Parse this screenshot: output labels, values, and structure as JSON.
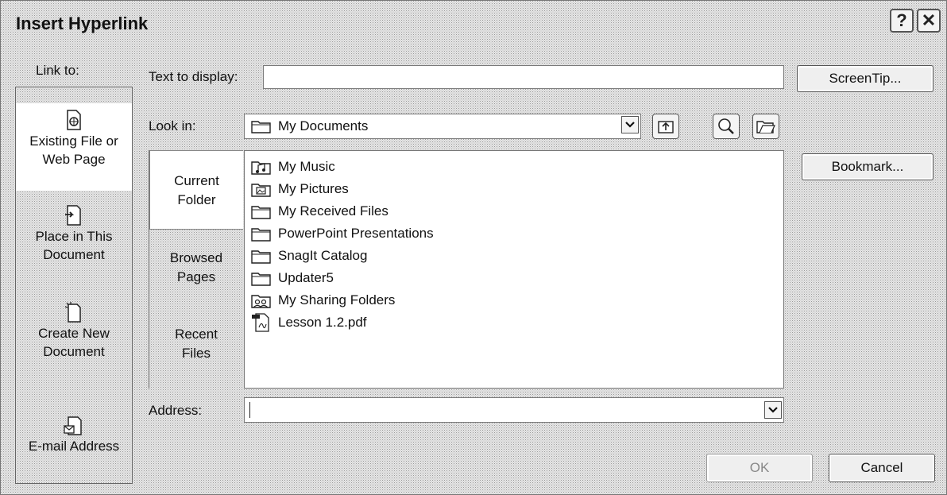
{
  "dialog": {
    "title": "Insert Hyperlink",
    "help_glyph": "?",
    "close_glyph": "✕"
  },
  "link_to": {
    "label": "Link to:",
    "items": [
      {
        "line1": "Existing File or",
        "line2": "Web Page",
        "icon": "existing-file-icon",
        "selected": true
      },
      {
        "line1": "Place in This",
        "line2": "Document",
        "icon": "place-in-document-icon",
        "selected": false
      },
      {
        "line1": "Create New",
        "line2": "Document",
        "icon": "create-new-document-icon",
        "selected": false
      },
      {
        "line1": "E-mail Address",
        "line2": "",
        "icon": "email-address-icon",
        "selected": false
      }
    ]
  },
  "text_to_display": {
    "label": "Text to display:",
    "value": ""
  },
  "screentip_label": "ScreenTip...",
  "look_in": {
    "label": "Look in:",
    "value": "My Documents"
  },
  "nav_tabs": [
    {
      "line1": "Current",
      "line2": "Folder",
      "selected": true
    },
    {
      "line1": "Browsed",
      "line2": "Pages",
      "selected": false
    },
    {
      "line1": "Recent",
      "line2": "Files",
      "selected": false
    }
  ],
  "files": [
    {
      "name": "My Music",
      "icon": "music-folder-icon"
    },
    {
      "name": "My Pictures",
      "icon": "pictures-folder-icon"
    },
    {
      "name": "My Received Files",
      "icon": "folder-icon"
    },
    {
      "name": "PowerPoint Presentations",
      "icon": "folder-icon"
    },
    {
      "name": "SnagIt Catalog",
      "icon": "folder-icon"
    },
    {
      "name": "Updater5",
      "icon": "folder-icon"
    },
    {
      "name": "My Sharing Folders",
      "icon": "sharing-folder-icon"
    },
    {
      "name": "Lesson 1.2.pdf",
      "icon": "pdf-file-icon"
    }
  ],
  "bookmark_label": "Bookmark...",
  "address": {
    "label": "Address:",
    "value": ""
  },
  "ok_label": "OK",
  "cancel_label": "Cancel"
}
